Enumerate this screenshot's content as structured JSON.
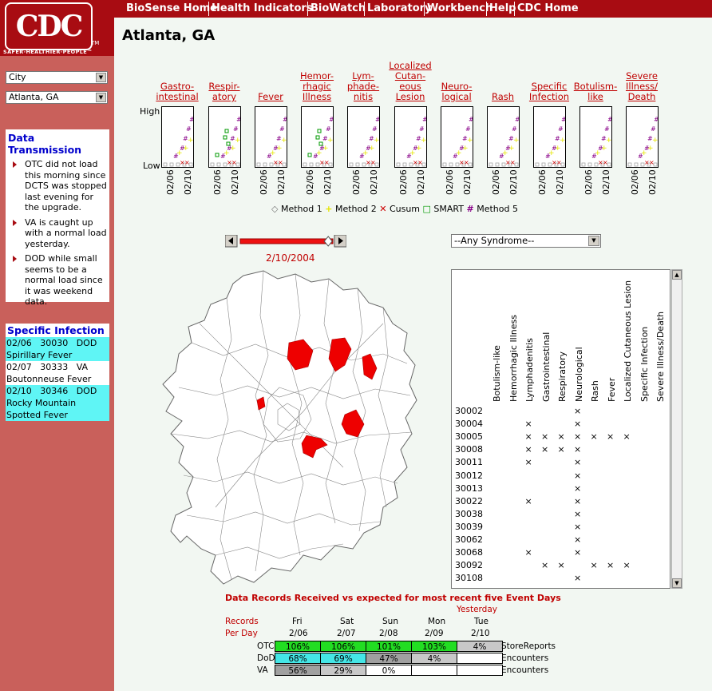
{
  "logo": {
    "text": "CDC",
    "tm": "TM",
    "tagline": "SAFER·HEALTHIER·PEOPLE™"
  },
  "nav": [
    "BioSense Home",
    "Health Indicators",
    "BioWatch",
    "Laboratory",
    "Workbench",
    "Help",
    "CDC Home"
  ],
  "page_title": "Atlanta, GA",
  "selects": {
    "level": "City",
    "location": "Atlanta, GA",
    "syndrome": "--Any Syndrome--"
  },
  "data_transmission": {
    "title": "Data Transmission",
    "items": [
      "OTC did not load this morning since DCTS was stopped last evening for the upgrade.",
      "VA is caught up with a normal load yesterday.",
      "DOD while small seems to be a normal load since it was weekend data."
    ]
  },
  "specific_infection": {
    "title": "Specific Infection",
    "items": [
      {
        "date": "02/06",
        "zip": "30030",
        "src": "DOD",
        "name": "Spirillary Fever",
        "highlight": true
      },
      {
        "date": "02/07",
        "zip": "30333",
        "src": "VA",
        "name": "Boutonneuse Fever",
        "highlight": false
      },
      {
        "date": "02/10",
        "zip": "30346",
        "src": "DOD",
        "name": "Rocky Mountain Spotted Fever",
        "highlight": true
      }
    ]
  },
  "syndromes": [
    "Gastro-\nintestinal",
    "Respir-\natory",
    "Fever",
    "Hemor-\nrhagic\nIllness",
    "Lym-\nphade-\nnitis",
    "Localized\nCutan-\neous\nLesion",
    "Neuro-\nlogical",
    "Rash",
    "Specific\nInfection",
    "Botulism-\nlike",
    "Severe\nIllness/\nDeath"
  ],
  "mini_axis": {
    "high": "High",
    "low": "Low",
    "ticks": [
      "02/06",
      "02/10"
    ]
  },
  "legend": [
    {
      "symbol": "◇",
      "label": "Method 1",
      "color": "#777777"
    },
    {
      "symbol": "+",
      "label": "Method 2",
      "color": "#e6e600"
    },
    {
      "symbol": "✕",
      "label": "Cusum",
      "color": "#cc0000"
    },
    {
      "symbol": "□",
      "label": "SMART",
      "color": "#009900"
    },
    {
      "symbol": "#",
      "label": "Method 5",
      "color": "#880088"
    }
  ],
  "slider": {
    "date": "2/10/2004",
    "position_pct": 95
  },
  "grid": {
    "columns": [
      "Botulism-like",
      "Hemorrhagic Illness",
      "Lymphadenitis",
      "Gastrointestinal",
      "Respiratory",
      "Neurological",
      "Rash",
      "Fever",
      "Localized Cutaneous Lesion",
      "Specific Infection",
      "Severe Illness/Death"
    ],
    "rows": [
      {
        "zip": "30002",
        "marks": [
          4
        ]
      },
      {
        "zip": "30004",
        "marks": [
          1,
          4
        ]
      },
      {
        "zip": "30005",
        "marks": [
          1,
          2,
          3,
          4,
          5,
          6,
          7
        ]
      },
      {
        "zip": "30008",
        "marks": [
          1,
          2,
          3,
          4
        ]
      },
      {
        "zip": "30011",
        "marks": [
          1,
          4
        ]
      },
      {
        "zip": "30012",
        "marks": [
          4
        ]
      },
      {
        "zip": "30013",
        "marks": [
          4
        ]
      },
      {
        "zip": "30022",
        "marks": [
          1,
          4
        ]
      },
      {
        "zip": "30038",
        "marks": [
          4
        ]
      },
      {
        "zip": "30039",
        "marks": [
          4
        ]
      },
      {
        "zip": "30062",
        "marks": [
          4
        ]
      },
      {
        "zip": "30068",
        "marks": [
          1,
          4
        ]
      },
      {
        "zip": "30092",
        "marks": [
          2,
          3,
          5,
          6,
          7
        ]
      },
      {
        "zip": "30108",
        "marks": [
          4
        ]
      }
    ]
  },
  "records": {
    "title": "Data Records Received vs expected for most recent five Event Days",
    "yesterday": "Yesterday",
    "label1": "Records",
    "label2": "Per Day",
    "days": [
      "Fri",
      "Sat",
      "Sun",
      "Mon",
      "Tue"
    ],
    "dates": [
      "2/06",
      "2/07",
      "2/08",
      "2/09",
      "2/10"
    ],
    "rows": [
      {
        "name": "OTC",
        "values": [
          "106%",
          "106%",
          "101%",
          "103%",
          "4%"
        ],
        "colors": [
          "#22dd22",
          "#22dd22",
          "#22dd22",
          "#22dd22",
          "#c8c8c8"
        ],
        "type": "StoreReports"
      },
      {
        "name": "DoD",
        "values": [
          "68%",
          "69%",
          "47%",
          "4%",
          ""
        ],
        "colors": [
          "#44e6e6",
          "#44e6e6",
          "#a0a0a0",
          "#c8c8c8",
          "#ffffff"
        ],
        "type": "Encounters"
      },
      {
        "name": "VA",
        "values": [
          "56%",
          "29%",
          "0%",
          "",
          ""
        ],
        "colors": [
          "#a0a0a0",
          "#c8c8c8",
          "#ffffff",
          "#ffffff",
          "#ffffff"
        ],
        "type": "Encounters"
      }
    ]
  }
}
